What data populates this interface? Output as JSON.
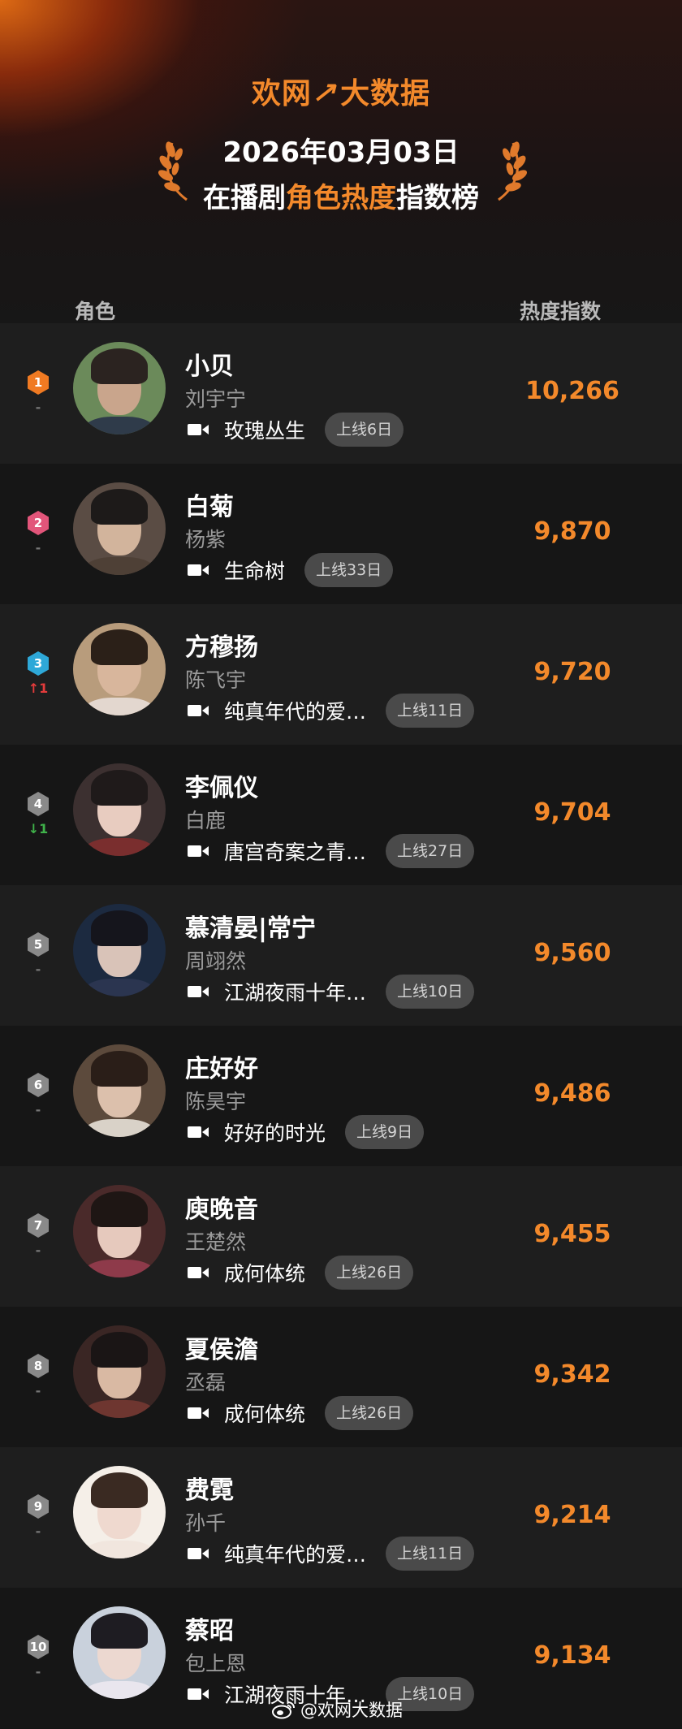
{
  "brand": {
    "name": "欢网",
    "arrow": "↗",
    "suffix": "大数据"
  },
  "title": {
    "date": "2026年03月03日",
    "prefix": "在播剧",
    "highlight": "角色热度",
    "suffix": "指数榜"
  },
  "columns": {
    "role": "角色",
    "index": "热度指数"
  },
  "rank_colors": {
    "1": "#f07a22",
    "2": "#e2557a",
    "3": "#2ea8d8",
    "other": "#8a8a8a"
  },
  "rows": [
    {
      "rank": "1",
      "change": "-",
      "change_dir": "none",
      "name": "小贝",
      "actor": "刘宇宁",
      "drama": "玫瑰丛生",
      "online": "上线6日",
      "score": "10,266"
    },
    {
      "rank": "2",
      "change": "-",
      "change_dir": "none",
      "name": "白菊",
      "actor": "杨紫",
      "drama": "生命树",
      "online": "上线33日",
      "score": "9,870"
    },
    {
      "rank": "3",
      "change": "↑1",
      "change_dir": "up",
      "name": "方穆扬",
      "actor": "陈飞宇",
      "drama": "纯真年代的爱…",
      "online": "上线11日",
      "score": "9,720"
    },
    {
      "rank": "4",
      "change": "↓1",
      "change_dir": "down",
      "name": "李佩仪",
      "actor": "白鹿",
      "drama": "唐宫奇案之青…",
      "online": "上线27日",
      "score": "9,704"
    },
    {
      "rank": "5",
      "change": "-",
      "change_dir": "none",
      "name": "慕清晏|常宁",
      "actor": "周翊然",
      "drama": "江湖夜雨十年…",
      "online": "上线10日",
      "score": "9,560"
    },
    {
      "rank": "6",
      "change": "-",
      "change_dir": "none",
      "name": "庄好好",
      "actor": "陈昊宇",
      "drama": "好好的时光",
      "online": "上线9日",
      "score": "9,486"
    },
    {
      "rank": "7",
      "change": "-",
      "change_dir": "none",
      "name": "庾晚音",
      "actor": "王楚然",
      "drama": "成何体统",
      "online": "上线26日",
      "score": "9,455"
    },
    {
      "rank": "8",
      "change": "-",
      "change_dir": "none",
      "name": "夏侯澹",
      "actor": "丞磊",
      "drama": "成何体统",
      "online": "上线26日",
      "score": "9,342"
    },
    {
      "rank": "9",
      "change": "-",
      "change_dir": "none",
      "name": "费霓",
      "actor": "孙千",
      "drama": "纯真年代的爱…",
      "online": "上线11日",
      "score": "9,214"
    },
    {
      "rank": "10",
      "change": "-",
      "change_dir": "none",
      "name": "蔡昭",
      "actor": "包上恩",
      "drama": "江湖夜雨十年…",
      "online": "上线10日",
      "score": "9,134"
    }
  ],
  "watermark": "@欢网大数据"
}
